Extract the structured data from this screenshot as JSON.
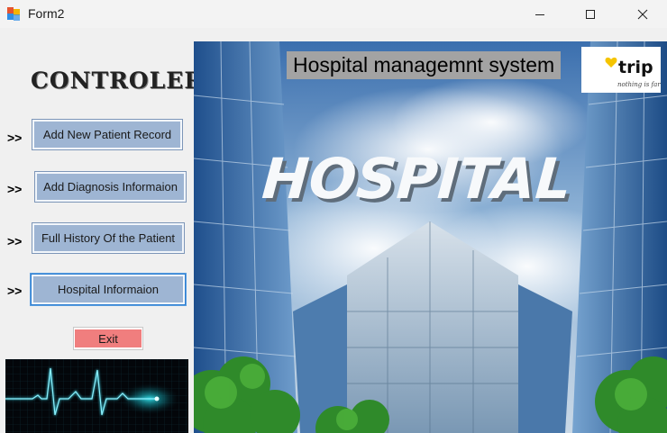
{
  "window": {
    "title": "Form2",
    "minimize_icon": "minimize-icon",
    "maximize_icon": "maximize-icon",
    "close_icon": "close-icon"
  },
  "sidebar": {
    "heading": "CONTROLER",
    "arrow": ">>",
    "buttons": [
      {
        "label": "Add New Patient Record"
      },
      {
        "label": "Add Diagnosis Informaion"
      },
      {
        "label": "Full History Of the Patient"
      },
      {
        "label": "Hospital Informaion"
      }
    ],
    "exit_label": "Exit"
  },
  "main": {
    "heading": "Hospital managemnt system",
    "hero_sign": "HOSPITAL",
    "logo_text": "trip",
    "logo_tagline": "nothing is far"
  },
  "colors": {
    "nav_button": "#9eb5d3",
    "exit_button": "#f07e7e",
    "heading_label_bg": "#a3a3a3",
    "ecg_line": "#3fd4e6"
  }
}
